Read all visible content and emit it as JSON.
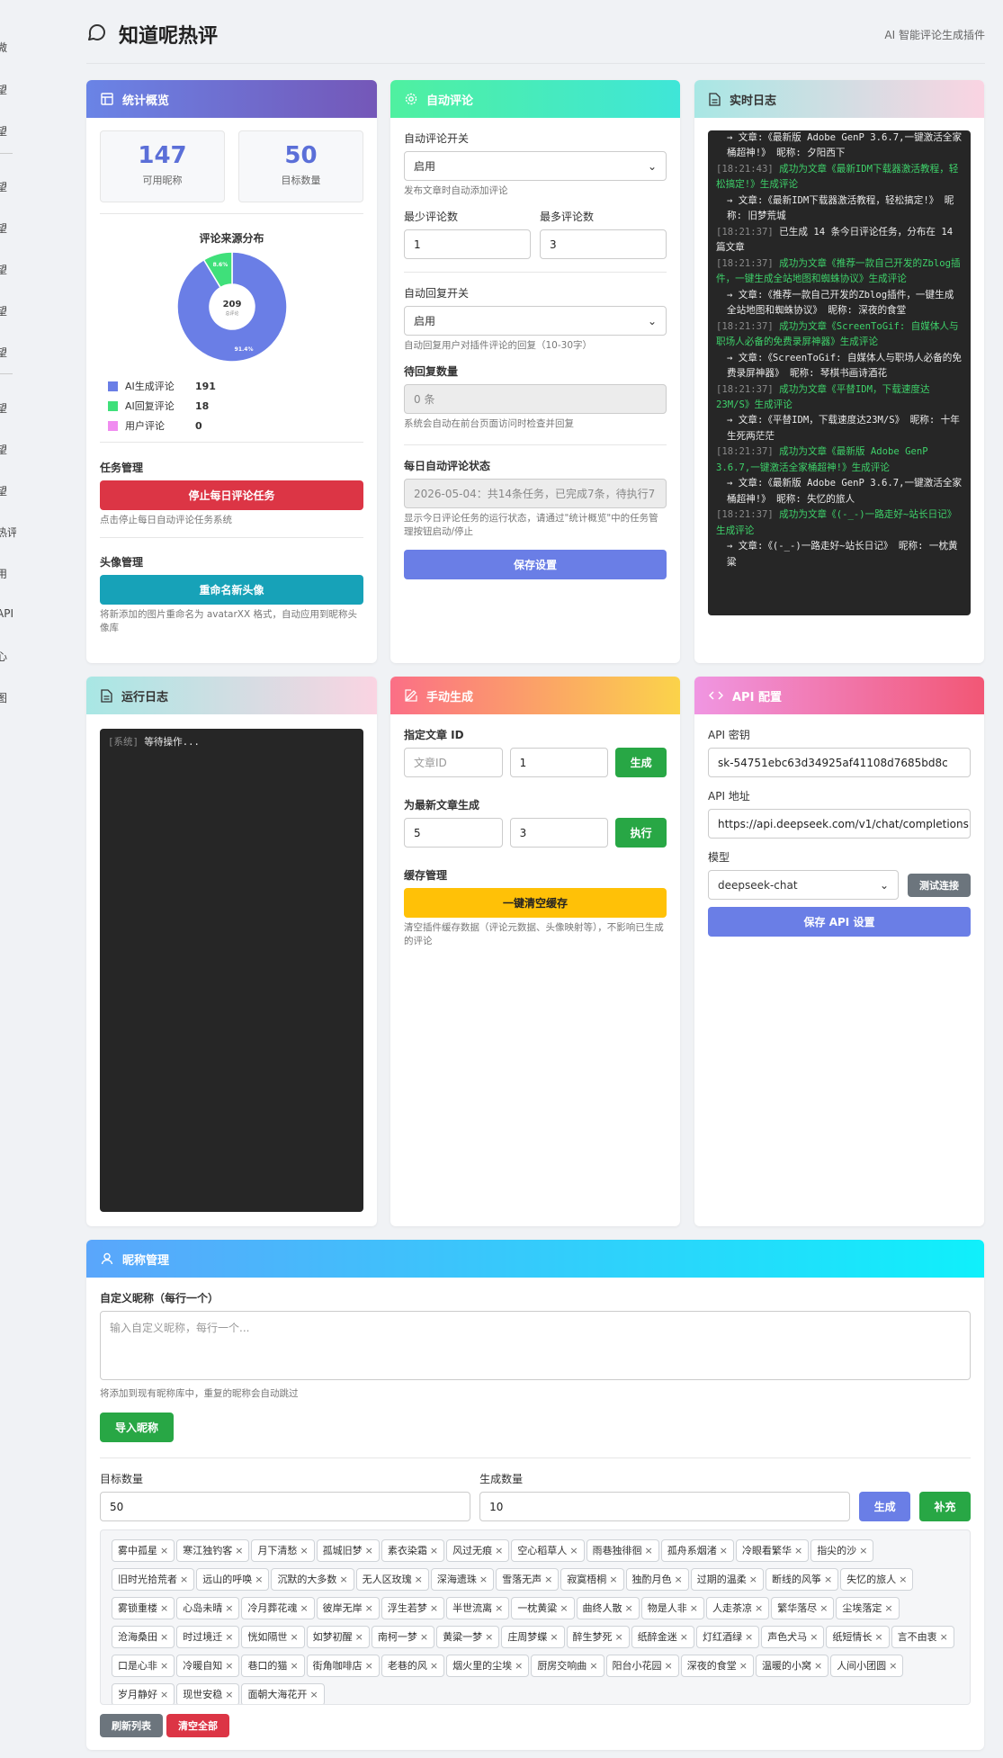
{
  "sidebar": {
    "items": [
      "微",
      "望",
      "望",
      "望",
      "望",
      "望",
      "望",
      "望",
      "望",
      "望",
      "望",
      "热评",
      "用",
      "API",
      "心",
      "图"
    ]
  },
  "header": {
    "title": "知道呢热评",
    "subtitle": "AI 智能评论生成插件"
  },
  "stats": {
    "title": "统计概览",
    "available_count": "147",
    "available_label": "可用昵称",
    "target_count": "50",
    "target_label": "目标数量",
    "source_title": "评论来源分布",
    "donut_total": "209",
    "donut_total_label": "总评论",
    "legend": [
      {
        "label": "AI生成评论",
        "value": "191",
        "color": "#6a7ee6"
      },
      {
        "label": "AI回复评论",
        "value": "18",
        "color": "#3fe07a"
      },
      {
        "label": "用户评论",
        "value": "0",
        "color": "#f08cf0"
      }
    ],
    "task_title": "任务管理",
    "task_button": "停止每日评论任务",
    "task_hint": "点击停止每日自动评论任务系统",
    "avatar_title": "头像管理",
    "avatar_button": "重命名新头像",
    "avatar_hint": "将新添加的图片重命名为 avatarXX 格式，自动应用到昵称头像库"
  },
  "chart_data": {
    "type": "pie",
    "title": "评论来源分布",
    "categories": [
      "AI生成评论",
      "AI回复评论",
      "用户评论"
    ],
    "values": [
      191,
      18,
      0
    ],
    "slice_labels": [
      "91.4%",
      "8.6%",
      ""
    ],
    "colors": [
      "#6a7ee6",
      "#3fe07a",
      "#f08cf0"
    ],
    "center_value": "209",
    "center_label": "总评论"
  },
  "auto": {
    "title": "自动评论",
    "toggle_label": "自动评论开关",
    "toggle_value": "启用",
    "toggle_hint": "发布文章时自动添加评论",
    "min_label": "最少评论数",
    "min_value": "1",
    "max_label": "最多评论数",
    "max_value": "3",
    "reply_label": "自动回复开关",
    "reply_value": "启用",
    "reply_hint": "自动回复用户对插件评论的回复（10-30字）",
    "pending_label": "待回复数量",
    "pending_value": "0 条",
    "pending_hint": "系统会自动在前台页面访问时检查并回复",
    "daily_label": "每日自动评论状态",
    "daily_value": "2026-05-04：共14条任务，已完成7条，待执行7",
    "daily_hint": "显示今日评论任务的运行状态，请通过\"统计概览\"中的任务管理按钮启动/停止",
    "save_button": "保存设置"
  },
  "realtime": {
    "title": "实时日志",
    "lines": [
      {
        "cls": "log-w log-ind",
        "text": "→ 文章:《最新版 Adobe GenP 3.6.7,一键激活全家桶超神!》 昵称: 夕阳西下"
      },
      {
        "cls": "log-g",
        "ts": "[18:21:43]",
        "text": "成功为文章《最新IDM下载器激活教程，轻松搞定!》生成评论"
      },
      {
        "cls": "log-w log-ind",
        "text": "→ 文章:《最新IDM下载器激活教程，轻松搞定!》 昵称: 旧梦荒城"
      },
      {
        "cls": "log-w",
        "ts": "[18:21:37]",
        "text": "已生成 14 条今日评论任务，分布在 14 篇文章"
      },
      {
        "cls": "log-g",
        "ts": "[18:21:37]",
        "text": "成功为文章《推荐一款自己开发的Zblog插件，一键生成全站地图和蜘蛛协议》生成评论"
      },
      {
        "cls": "log-w log-ind",
        "text": "→ 文章:《推荐一款自己开发的Zblog插件，一键生成全站地图和蜘蛛协议》 昵称: 深夜的食堂"
      },
      {
        "cls": "log-g",
        "ts": "[18:21:37]",
        "text": "成功为文章《ScreenToGif: 自媒体人与职场人必备的免费录屏神器》生成评论"
      },
      {
        "cls": "log-w log-ind",
        "text": "→ 文章:《ScreenToGif: 自媒体人与职场人必备的免费录屏神器》 昵称: 琴棋书画诗酒花"
      },
      {
        "cls": "log-g",
        "ts": "[18:21:37]",
        "text": "成功为文章《平替IDM，下载速度达23M/S》生成评论"
      },
      {
        "cls": "log-w log-ind",
        "text": "→ 文章:《平替IDM，下载速度达23M/S》 昵称: 十年生死两茫茫"
      },
      {
        "cls": "log-g",
        "ts": "[18:21:37]",
        "text": "成功为文章《最新版 Adobe GenP 3.6.7,一键激活全家桶超神!》生成评论"
      },
      {
        "cls": "log-w log-ind",
        "text": "→ 文章:《最新版 Adobe GenP 3.6.7,一键激活全家桶超神!》 昵称: 失忆的旅人"
      },
      {
        "cls": "log-g",
        "ts": "[18:21:37]",
        "text": "成功为文章《(-_-)一路走好~站长日记》生成评论"
      },
      {
        "cls": "log-w log-ind",
        "text": "→ 文章:《(-_-)一路走好~站长日记》 昵称: 一枕黄粱"
      }
    ]
  },
  "runlog": {
    "title": "运行日志",
    "system_tag": "[系统]",
    "system_text": "等待操作..."
  },
  "manual": {
    "title": "手动生成",
    "article_label": "指定文章 ID",
    "article_placeholder": "文章ID",
    "article_count": "1",
    "generate_button": "生成",
    "latest_label": "为最新文章生成",
    "latest_a": "5",
    "latest_b": "3",
    "execute_button": "执行",
    "cache_label": "缓存管理",
    "cache_button": "一键清空缓存",
    "cache_hint": "清空插件缓存数据（评论元数据、头像映射等），不影响已生成的评论"
  },
  "api": {
    "title": "API 配置",
    "key_label": "API 密钥",
    "key_value": "sk-54751ebc63d34925af41108d7685bd8c",
    "url_label": "API 地址",
    "url_value": "https://api.deepseek.com/v1/chat/completions",
    "model_label": "模型",
    "model_value": "deepseek-chat",
    "test_button": "测试连接",
    "save_button": "保存 API 设置"
  },
  "nick": {
    "title": "昵称管理",
    "custom_label": "自定义昵称（每行一个）",
    "custom_placeholder": "输入自定义昵称，每行一个...",
    "custom_hint": "将添加到现有昵称库中，重复的昵称会自动跳过",
    "import_button": "导入昵称",
    "target_label": "目标数量",
    "target_value": "50",
    "gen_label": "生成数量",
    "gen_value": "10",
    "gen_button": "生成",
    "fill_button": "补充",
    "refresh_button": "刷新列表",
    "clear_button": "清空全部",
    "tags": [
      "雾中孤星",
      "寒江独钓客",
      "月下清愁",
      "孤城旧梦",
      "素衣染霜",
      "风过无痕",
      "空心稻草人",
      "雨巷独徘徊",
      "孤舟系烟渚",
      "冷眼看繁华",
      "指尖的沙",
      "旧时光拾荒者",
      "远山的呼唤",
      "沉默的大多数",
      "无人区玫瑰",
      "深海遗珠",
      "雪落无声",
      "寂寞梧桐",
      "独酌月色",
      "过期的温柔",
      "断线的风筝",
      "失忆的旅人",
      "雾锁重楼",
      "心岛未晴",
      "冷月葬花魂",
      "彼岸无岸",
      "浮生若梦",
      "半世流离",
      "一枕黄粱",
      "曲终人散",
      "物是人非",
      "人走茶凉",
      "繁华落尽",
      "尘埃落定",
      "沧海桑田",
      "时过境迁",
      "恍如隔世",
      "如梦初醒",
      "南柯一梦",
      "黄粱一梦",
      "庄周梦蝶",
      "醉生梦死",
      "纸醉金迷",
      "灯红酒绿",
      "声色犬马",
      "纸短情长",
      "言不由衷",
      "口是心非",
      "冷暖自知",
      "巷口的猫",
      "街角咖啡店",
      "老巷的风",
      "烟火里的尘埃",
      "厨房交响曲",
      "阳台小花园",
      "深夜的食堂",
      "温暖的小窝",
      "人间小团圆",
      "岁月静好",
      "现世安稳",
      "面朝大海花开"
    ]
  }
}
